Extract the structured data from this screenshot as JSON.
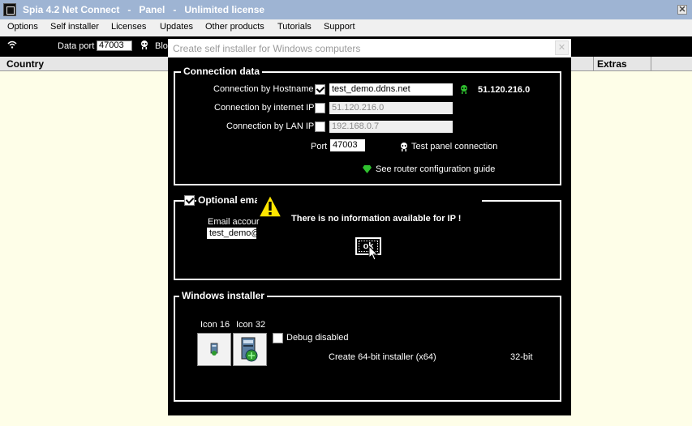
{
  "window": {
    "title": "Spia 4.2 Net Connect   -   Panel   -   Unlimited license",
    "close_glyph": "✕"
  },
  "menu": [
    "Options",
    "Self installer",
    "Licenses",
    "Updates",
    "Other products",
    "Tutorials",
    "Support"
  ],
  "toolbar": {
    "data_port_label": "Data port",
    "data_port_value": "47003",
    "blo_label": "Blo"
  },
  "table": {
    "col_country": "Country",
    "col_extras": "Extras"
  },
  "dialog": {
    "title": "Create self installer for Windows computers",
    "close_glyph": "✕",
    "connection": {
      "group_title": "Connection data",
      "hostname_label": "Connection by Hostname",
      "hostname_value": "test_demo.ddns.net",
      "hostname_checked": true,
      "resolved_ip": "51.120.216.0",
      "internet_ip_label": "Connection by internet IP",
      "internet_ip_value": "51.120.216.0",
      "lan_ip_label": "Connection by LAN IP",
      "lan_ip_value": "192.168.0.7",
      "port_label": "Port",
      "port_value": "47003",
      "test_panel_label": "Test panel connection",
      "router_guide_label": "See router configuration guide"
    },
    "email": {
      "group_title": "Optional ema",
      "account_label": "Email accour",
      "account_value": "test_demo@"
    },
    "installer": {
      "group_title": "Windows installer",
      "icon16_label": "Icon 16",
      "icon32_label": "Icon 32",
      "debug_label": "Debug disabled",
      "create64_label": "Create 64-bit installer  (x64)",
      "bit32_label": "32-bit"
    }
  },
  "message": {
    "text": "There is no information available for IP !",
    "ok_label": "ok"
  },
  "colors": {
    "accent": "#9eb4d3",
    "table_bg": "#fefee8",
    "green": "#2fc12f"
  }
}
